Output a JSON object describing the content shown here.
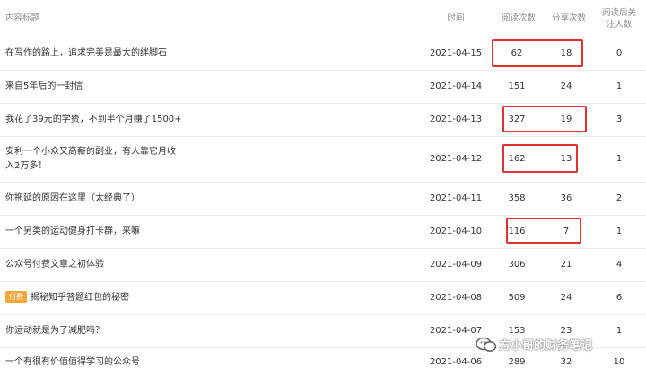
{
  "header": {
    "title_col": "内容标题",
    "time_col": "时间",
    "read_col": "阅读次数",
    "share_col": "分享次数",
    "follow_col": "阅读后关注人数"
  },
  "rows": [
    {
      "title": "在写作的路上，追求完美是最大的绊脚石",
      "date": "2021-04-15",
      "reads": "62",
      "shares": "18",
      "follows": "0",
      "highlighted": true
    },
    {
      "title": "来自5年后的一封信",
      "date": "2021-04-14",
      "reads": "151",
      "shares": "24",
      "follows": "1",
      "highlighted": false
    },
    {
      "title": "我花了39元的学费，不到半个月赚了1500+",
      "date": "2021-04-13",
      "reads": "327",
      "shares": "19",
      "follows": "3",
      "highlighted": true
    },
    {
      "title": "安利一个小众又高薪的副业，有人靠它月收入2万多！",
      "date": "2021-04-12",
      "reads": "162",
      "shares": "13",
      "follows": "1",
      "highlighted": true
    },
    {
      "title": "你拖延的原因在这里（太经典了）",
      "date": "2021-04-11",
      "reads": "358",
      "shares": "36",
      "follows": "2",
      "highlighted": false
    },
    {
      "title": "一个另类的运动健身打卡群，来嘛",
      "date": "2021-04-10",
      "reads": "116",
      "shares": "7",
      "follows": "1",
      "highlighted": true
    },
    {
      "title": "公众号付费文章之初体验",
      "date": "2021-04-09",
      "reads": "306",
      "shares": "21",
      "follows": "4",
      "highlighted": false
    },
    {
      "title": "揭秘知乎答题红包的秘密",
      "tag": "付费",
      "date": "2021-04-08",
      "reads": "509",
      "shares": "24",
      "follows": "6",
      "highlighted": false
    },
    {
      "title": "你运动就是为了减肥吗？",
      "date": "2021-04-07",
      "reads": "153",
      "shares": "23",
      "follows": "1",
      "highlighted": false
    },
    {
      "title": "一个有很有价值值得学习的公众号",
      "date": "2021-04-06",
      "reads": "289",
      "shares": "32",
      "follows": "10",
      "highlighted": false
    }
  ],
  "watermark": {
    "text": "方小哥的财务笔记"
  },
  "colors": {
    "highlight_box": "#e0332f",
    "paid_tag": "#f0a83a"
  }
}
